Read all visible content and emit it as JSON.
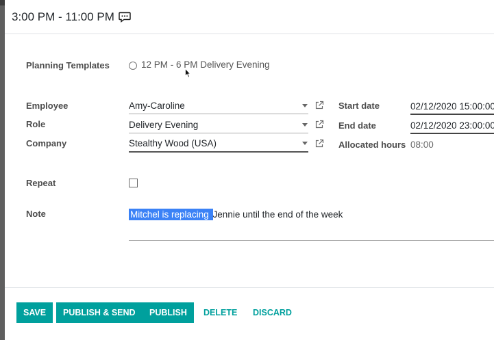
{
  "dialog": {
    "title": "3:00 PM - 11:00 PM",
    "title_icon": "chat-bubble-icon"
  },
  "form": {
    "planning_templates": {
      "label": "Planning Templates",
      "option": "12 PM - 6 PM Delivery Evening"
    },
    "employee": {
      "label": "Employee",
      "value": "Amy-Caroline"
    },
    "role": {
      "label": "Role",
      "value": "Delivery Evening"
    },
    "company": {
      "label": "Company",
      "value": "Stealthy Wood (USA)"
    },
    "start_date": {
      "label": "Start date",
      "value": "02/12/2020 15:00:00"
    },
    "end_date": {
      "label": "End date",
      "value": "02/12/2020 23:00:00"
    },
    "allocated_hours": {
      "label": "Allocated hours",
      "value": "08:00"
    },
    "repeat": {
      "label": "Repeat",
      "checked": false
    },
    "note": {
      "label": "Note",
      "selected_text": "Mitchel is replacing ",
      "rest_text": "Jennie until the end of the week"
    }
  },
  "footer": {
    "save": "SAVE",
    "publish_send": "PUBLISH & SEND",
    "publish": "PUBLISH",
    "delete": "DELETE",
    "discard": "DISCARD"
  },
  "colors": {
    "accent": "#00a09d",
    "selection": "#3b82f6"
  }
}
